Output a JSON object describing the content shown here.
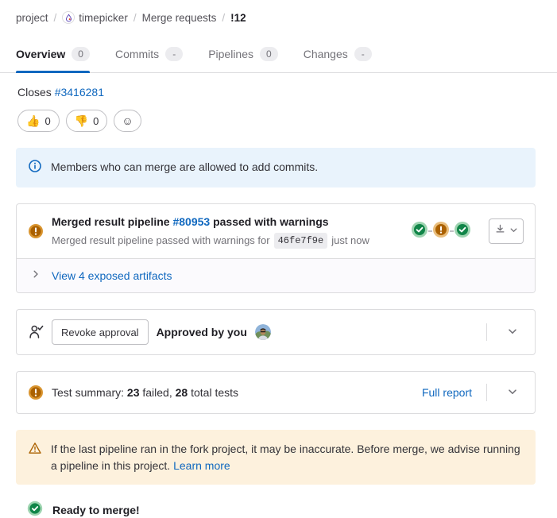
{
  "breadcrumb": {
    "project": "project",
    "group": "timepicker",
    "section": "Merge requests",
    "current": "!12",
    "separator": "/",
    "avatar_icon": "project-avatar-icon"
  },
  "tabs": [
    {
      "label": "Overview",
      "badge": "0",
      "active": true
    },
    {
      "label": "Commits",
      "badge": "-",
      "active": false
    },
    {
      "label": "Pipelines",
      "badge": "0",
      "active": false
    },
    {
      "label": "Changes",
      "badge": "-",
      "active": false
    }
  ],
  "closes": {
    "prefix": "Closes",
    "issue": "#3416281"
  },
  "awards": {
    "thumbsup": {
      "emoji": "👍",
      "count": "0"
    },
    "thumbsdown": {
      "emoji": "👎",
      "count": "0"
    },
    "add_label": "☺"
  },
  "info_alert": {
    "icon": "information-circle-icon",
    "text": "Members who can merge are allowed to add commits."
  },
  "pipeline_widget": {
    "status_icon": "warning-filled-icon",
    "title_prefix": "Merged result pipeline",
    "pipeline_id": "#80953",
    "title_suffix": "passed with warnings",
    "sub_prefix": "Merged result pipeline passed with warnings for",
    "sha": "46fe7f9e",
    "sub_time": "just now",
    "stages": [
      "success",
      "warning",
      "success"
    ],
    "artifacts_label": "View 4 exposed artifacts",
    "download_icon": "download-icon",
    "expand_icon": "chevron-right-icon"
  },
  "approval_widget": {
    "icon": "approval-user-check-icon",
    "revoke_label": "Revoke approval",
    "approved_text": "Approved by you",
    "avatar": "user-avatar",
    "expand_icon": "chevron-down-icon"
  },
  "test_widget": {
    "status_icon": "warning-filled-icon",
    "label": "Test summary:",
    "failed_count": "23",
    "failed_label": "failed,",
    "total_count": "28",
    "total_label": "total tests",
    "report_link": "Full report",
    "expand_icon": "chevron-down-icon"
  },
  "warning_alert": {
    "icon": "warning-triangle-icon",
    "text": "If the last pipeline ran in the fork project, it may be inaccurate. Before merge, we advise running a pipeline in this project.",
    "link": "Learn more"
  },
  "ready": {
    "icon": "success-check-icon",
    "text": "Ready to merge!"
  },
  "colors": {
    "link": "#1068bf",
    "success": "#108548",
    "warning": "#ab6100",
    "info_bg": "#e9f3fc",
    "warning_bg": "#fdf1dd",
    "border": "#dcdcde"
  }
}
